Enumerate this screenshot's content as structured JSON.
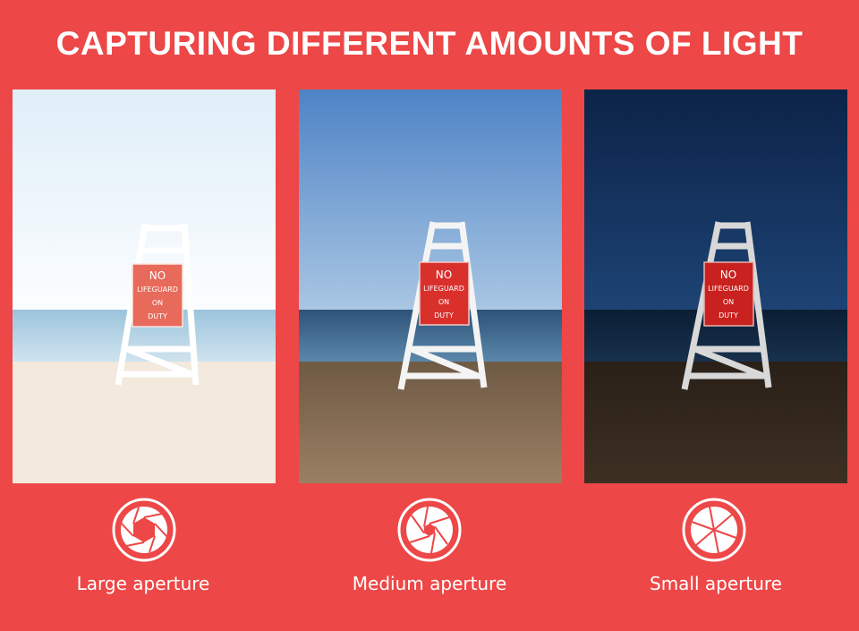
{
  "title": "CAPTURING DIFFERENT AMOUNTS OF LIGHT",
  "colors": {
    "background": "#ed4747",
    "text": "#ffffff"
  },
  "panels": [
    {
      "label": "Large aperture",
      "icon": "aperture-wide-icon",
      "sign": [
        "NO",
        "LIFEGUARD",
        "ON",
        "DUTY"
      ]
    },
    {
      "label": "Medium aperture",
      "icon": "aperture-medium-icon",
      "sign": [
        "NO",
        "LIFEGUARD",
        "ON",
        "DUTY"
      ]
    },
    {
      "label": "Small aperture",
      "icon": "aperture-small-icon",
      "sign": [
        "NO",
        "LIFEGUARD",
        "ON",
        "DUTY"
      ]
    }
  ]
}
